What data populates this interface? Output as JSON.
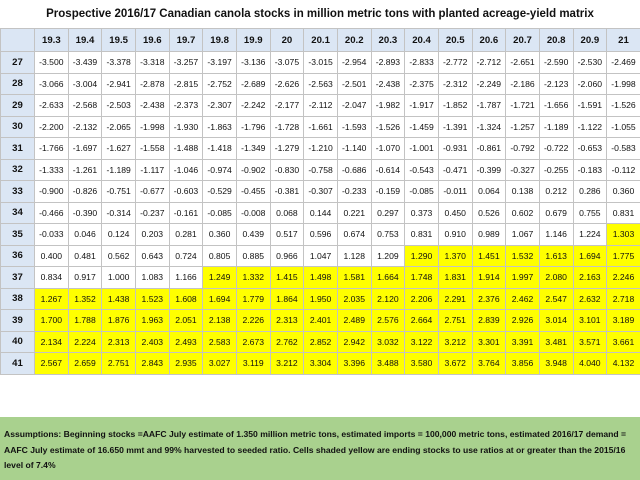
{
  "title": "Prospective 2016/17 Canadian canola stocks in million metric tons with planted acreage-yield matrix",
  "highlight_color": "#ffff00",
  "header_color": "#dbe6f4",
  "notes_color": "#a9d18e",
  "columns": [
    "19.3",
    "19.4",
    "19.5",
    "19.6",
    "19.7",
    "19.8",
    "19.9",
    "20",
    "20.1",
    "20.2",
    "20.3",
    "20.4",
    "20.5",
    "20.6",
    "20.7",
    "20.8",
    "20.9",
    "21"
  ],
  "rows": [
    {
      "label": "27",
      "values": [
        "-3.500",
        "-3.439",
        "-3.378",
        "-3.318",
        "-3.257",
        "-3.197",
        "-3.136",
        "-3.075",
        "-3.015",
        "-2.954",
        "-2.893",
        "-2.833",
        "-2.772",
        "-2.712",
        "-2.651",
        "-2.590",
        "-2.530",
        "-2.469"
      ],
      "highlight_from": -1
    },
    {
      "label": "28",
      "values": [
        "-3.066",
        "-3.004",
        "-2.941",
        "-2.878",
        "-2.815",
        "-2.752",
        "-2.689",
        "-2.626",
        "-2.563",
        "-2.501",
        "-2.438",
        "-2.375",
        "-2.312",
        "-2.249",
        "-2.186",
        "-2.123",
        "-2.060",
        "-1.998"
      ],
      "highlight_from": -1
    },
    {
      "label": "29",
      "values": [
        "-2.633",
        "-2.568",
        "-2.503",
        "-2.438",
        "-2.373",
        "-2.307",
        "-2.242",
        "-2.177",
        "-2.112",
        "-2.047",
        "-1.982",
        "-1.917",
        "-1.852",
        "-1.787",
        "-1.721",
        "-1.656",
        "-1.591",
        "-1.526"
      ],
      "highlight_from": -1
    },
    {
      "label": "30",
      "values": [
        "-2.200",
        "-2.132",
        "-2.065",
        "-1.998",
        "-1.930",
        "-1.863",
        "-1.796",
        "-1.728",
        "-1.661",
        "-1.593",
        "-1.526",
        "-1.459",
        "-1.391",
        "-1.324",
        "-1.257",
        "-1.189",
        "-1.122",
        "-1.055"
      ],
      "highlight_from": -1
    },
    {
      "label": "31",
      "values": [
        "-1.766",
        "-1.697",
        "-1.627",
        "-1.558",
        "-1.488",
        "-1.418",
        "-1.349",
        "-1.279",
        "-1.210",
        "-1.140",
        "-1.070",
        "-1.001",
        "-0.931",
        "-0.861",
        "-0.792",
        "-0.722",
        "-0.653",
        "-0.583"
      ],
      "highlight_from": -1
    },
    {
      "label": "32",
      "values": [
        "-1.333",
        "-1.261",
        "-1.189",
        "-1.117",
        "-1.046",
        "-0.974",
        "-0.902",
        "-0.830",
        "-0.758",
        "-0.686",
        "-0.614",
        "-0.543",
        "-0.471",
        "-0.399",
        "-0.327",
        "-0.255",
        "-0.183",
        "-0.112"
      ],
      "highlight_from": -1
    },
    {
      "label": "33",
      "values": [
        "-0.900",
        "-0.826",
        "-0.751",
        "-0.677",
        "-0.603",
        "-0.529",
        "-0.455",
        "-0.381",
        "-0.307",
        "-0.233",
        "-0.159",
        "-0.085",
        "-0.011",
        "0.064",
        "0.138",
        "0.212",
        "0.286",
        "0.360"
      ],
      "highlight_from": -1
    },
    {
      "label": "34",
      "values": [
        "-0.466",
        "-0.390",
        "-0.314",
        "-0.237",
        "-0.161",
        "-0.085",
        "-0.008",
        "0.068",
        "0.144",
        "0.221",
        "0.297",
        "0.373",
        "0.450",
        "0.526",
        "0.602",
        "0.679",
        "0.755",
        "0.831"
      ],
      "highlight_from": -1
    },
    {
      "label": "35",
      "values": [
        "-0.033",
        "0.046",
        "0.124",
        "0.203",
        "0.281",
        "0.360",
        "0.439",
        "0.517",
        "0.596",
        "0.674",
        "0.753",
        "0.831",
        "0.910",
        "0.989",
        "1.067",
        "1.146",
        "1.224",
        "1.303"
      ],
      "highlight_from": 17
    },
    {
      "label": "36",
      "values": [
        "0.400",
        "0.481",
        "0.562",
        "0.643",
        "0.724",
        "0.805",
        "0.885",
        "0.966",
        "1.047",
        "1.128",
        "1.209",
        "1.290",
        "1.370",
        "1.451",
        "1.532",
        "1.613",
        "1.694",
        "1.775"
      ],
      "highlight_from": 11
    },
    {
      "label": "37",
      "values": [
        "0.834",
        "0.917",
        "1.000",
        "1.083",
        "1.166",
        "1.249",
        "1.332",
        "1.415",
        "1.498",
        "1.581",
        "1.664",
        "1.748",
        "1.831",
        "1.914",
        "1.997",
        "2.080",
        "2.163",
        "2.246"
      ],
      "highlight_from": 5
    },
    {
      "label": "38",
      "values": [
        "1.267",
        "1.352",
        "1.438",
        "1.523",
        "1.608",
        "1.694",
        "1.779",
        "1.864",
        "1.950",
        "2.035",
        "2.120",
        "2.206",
        "2.291",
        "2.376",
        "2.462",
        "2.547",
        "2.632",
        "2.718"
      ],
      "highlight_from": 0
    },
    {
      "label": "39",
      "values": [
        "1.700",
        "1.788",
        "1.876",
        "1.963",
        "2.051",
        "2.138",
        "2.226",
        "2.313",
        "2.401",
        "2.489",
        "2.576",
        "2.664",
        "2.751",
        "2.839",
        "2.926",
        "3.014",
        "3.101",
        "3.189"
      ],
      "highlight_from": 0
    },
    {
      "label": "40",
      "values": [
        "2.134",
        "2.224",
        "2.313",
        "2.403",
        "2.493",
        "2.583",
        "2.673",
        "2.762",
        "2.852",
        "2.942",
        "3.032",
        "3.122",
        "3.212",
        "3.301",
        "3.391",
        "3.481",
        "3.571",
        "3.661"
      ],
      "highlight_from": 0
    },
    {
      "label": "41",
      "values": [
        "2.567",
        "2.659",
        "2.751",
        "2.843",
        "2.935",
        "3.027",
        "3.119",
        "3.212",
        "3.304",
        "3.396",
        "3.488",
        "3.580",
        "3.672",
        "3.764",
        "3.856",
        "3.948",
        "4.040",
        "4.132"
      ],
      "highlight_from": 0
    }
  ],
  "notes": "Assumptions: Beginning stocks =AAFC July estimate of 1.350 million metric tons, estimated imports = 100,000 metric tons, estimated 2016/17 demand = AAFC July estimate of 16.650 mmt and 99% harvested to seeded ratio. Cells shaded yellow are ending stocks to use ratios at or greater than the 2015/16 level of 7.4%"
}
